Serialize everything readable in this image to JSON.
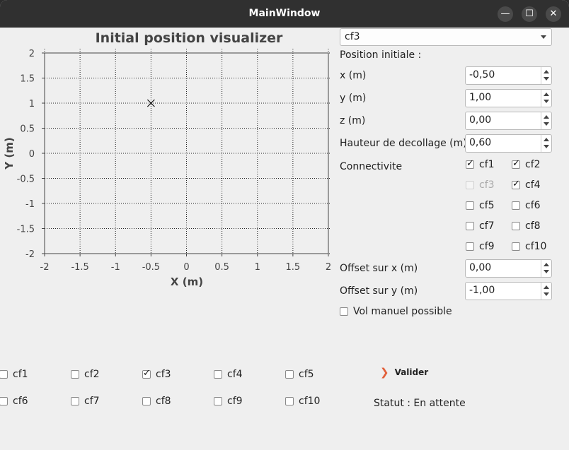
{
  "window": {
    "title": "MainWindow"
  },
  "chart_data": {
    "type": "scatter",
    "title": "Initial position visualizer",
    "xlabel": "X (m)",
    "ylabel": "Y (m)",
    "xlim": [
      -2,
      2
    ],
    "ylim": [
      -2,
      2
    ],
    "xticks": [
      "-2",
      "-1.5",
      "-1",
      "-0.5",
      "0",
      "0.5",
      "1",
      "1.5",
      "2"
    ],
    "yticks": [
      "2",
      "1.5",
      "1",
      "0.5",
      "0",
      "-0.5",
      "-1",
      "-1.5",
      "-2"
    ],
    "grid": true,
    "points": [
      {
        "x": -0.5,
        "y": 1,
        "marker": "x"
      }
    ]
  },
  "drone_select": {
    "value": "cf3"
  },
  "form": {
    "position_label": "Position initiale :",
    "x_label": "x (m)",
    "x_value": "-0,50",
    "y_label": "y (m)",
    "y_value": "1,00",
    "z_label": "z (m)",
    "z_value": "0,00",
    "height_label": "Hauteur de decollage (m)",
    "height_value": "0,60",
    "connectivity_label": "Connectivite",
    "offset_x_label": "Offset sur x (m)",
    "offset_x_value": "0,00",
    "offset_y_label": "Offset sur y (m)",
    "offset_y_value": "-1,00",
    "manual_label": "Vol manuel possible"
  },
  "connectivity": [
    {
      "label": "cf1",
      "checked": true,
      "disabled": false
    },
    {
      "label": "cf2",
      "checked": true,
      "disabled": false
    },
    {
      "label": "cf3",
      "checked": false,
      "disabled": true
    },
    {
      "label": "cf4",
      "checked": true,
      "disabled": false
    },
    {
      "label": "cf5",
      "checked": false,
      "disabled": false
    },
    {
      "label": "cf6",
      "checked": false,
      "disabled": false
    },
    {
      "label": "cf7",
      "checked": false,
      "disabled": false
    },
    {
      "label": "cf8",
      "checked": false,
      "disabled": false
    },
    {
      "label": "cf9",
      "checked": false,
      "disabled": false
    },
    {
      "label": "cf10",
      "checked": false,
      "disabled": false
    }
  ],
  "bottom_drones": [
    {
      "label": "cf1",
      "checked": false
    },
    {
      "label": "cf2",
      "checked": false
    },
    {
      "label": "cf3",
      "checked": true
    },
    {
      "label": "cf4",
      "checked": false
    },
    {
      "label": "cf5",
      "checked": false
    },
    {
      "label": "cf6",
      "checked": false
    },
    {
      "label": "cf7",
      "checked": false
    },
    {
      "label": "cf8",
      "checked": false
    },
    {
      "label": "cf9",
      "checked": false
    },
    {
      "label": "cf10",
      "checked": false
    }
  ],
  "actions": {
    "valider_label": "Valider",
    "status_text": "Statut : En attente"
  }
}
